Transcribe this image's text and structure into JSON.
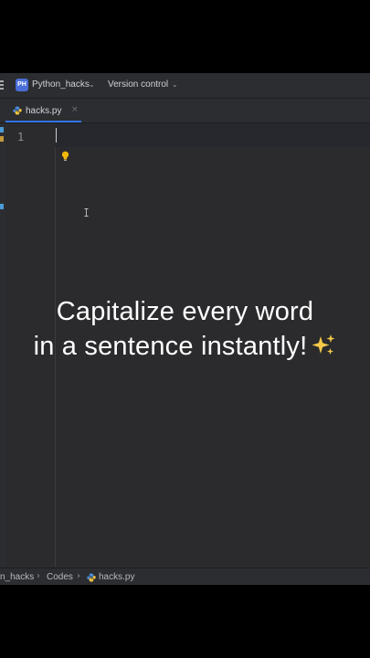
{
  "toolbar": {
    "project_badge": "PH",
    "project_name": "Python_hacks",
    "version_control": "Version control",
    "accent_color": "#4a6ed8"
  },
  "tabs": [
    {
      "label": "hacks.py",
      "close_glyph": "×",
      "icon": "python-file-icon",
      "active": true
    }
  ],
  "editor": {
    "line_numbers": [
      "1"
    ],
    "content": "",
    "hint_icon": "lightbulb-icon"
  },
  "caption": {
    "line1": "Capitalize every word",
    "line2": "in a sentence instantly!",
    "emoji_icon": "sparkles-icon"
  },
  "statusbar": {
    "breadcrumbs": [
      "n_hacks",
      "Codes",
      "hacks.py"
    ]
  }
}
